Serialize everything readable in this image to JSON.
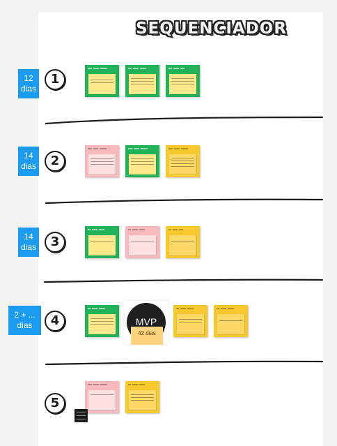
{
  "title": "SEQUENCIADOR",
  "rows": [
    {
      "number": "1",
      "badge": {
        "line1": "12",
        "line2": "dias"
      }
    },
    {
      "number": "2",
      "badge": {
        "line1": "14",
        "line2": "dias"
      }
    },
    {
      "number": "3",
      "badge": {
        "line1": "14",
        "line2": "dias"
      }
    },
    {
      "number": "4",
      "badge": {
        "line1": "2 + ...",
        "line2": "dias"
      }
    },
    {
      "number": "5"
    }
  ],
  "card_colors": {
    "green": "#22b35a",
    "pink": "#f7b9bb",
    "yellow": "#f7c92e"
  },
  "mvp": {
    "label": "MVP",
    "note": "42 dias"
  }
}
